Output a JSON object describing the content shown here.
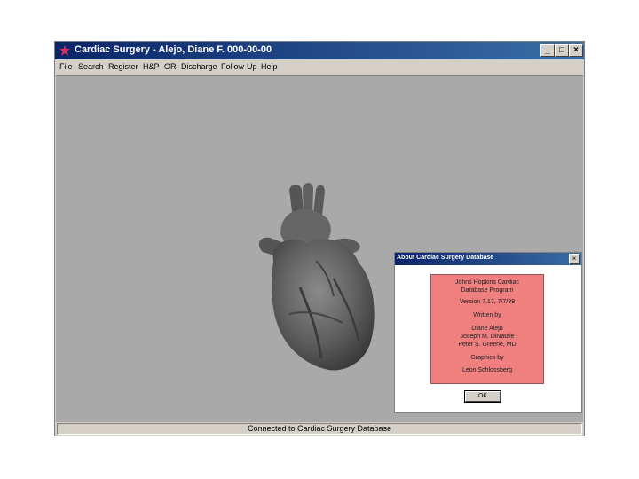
{
  "window": {
    "title": "Cardiac Surgery - Alejo, Diane F.   000-00-00",
    "minimize_label": "_",
    "maximize_label": "□",
    "close_label": "×"
  },
  "menu": [
    "File",
    "Search",
    "Register",
    "H&P",
    "OR",
    "Discharge",
    "Follow-Up",
    "Help"
  ],
  "status_text": "Connected to Cardiac Surgery Database",
  "about_dialog": {
    "title": "About Cardiac Surgery Database",
    "close_label": "×",
    "lines": [
      "Johns Hopkins Cardiac",
      "Database Program",
      "",
      "Version 7.17, 7/7/99",
      "",
      "Written by",
      "",
      "Diane Alejo",
      "Joseph M. DiNatale",
      "Peter S. Greene, MD",
      "",
      "Graphics by",
      "",
      "Leon Schlossberg"
    ],
    "ok_label": "OK"
  },
  "colors": {
    "title_bar": "#0a246a",
    "client_background": "#a9a9a9",
    "credits_background": "#f08080"
  },
  "icons": {
    "app": "heart-star-icon",
    "illustration": "heart-illustration"
  }
}
